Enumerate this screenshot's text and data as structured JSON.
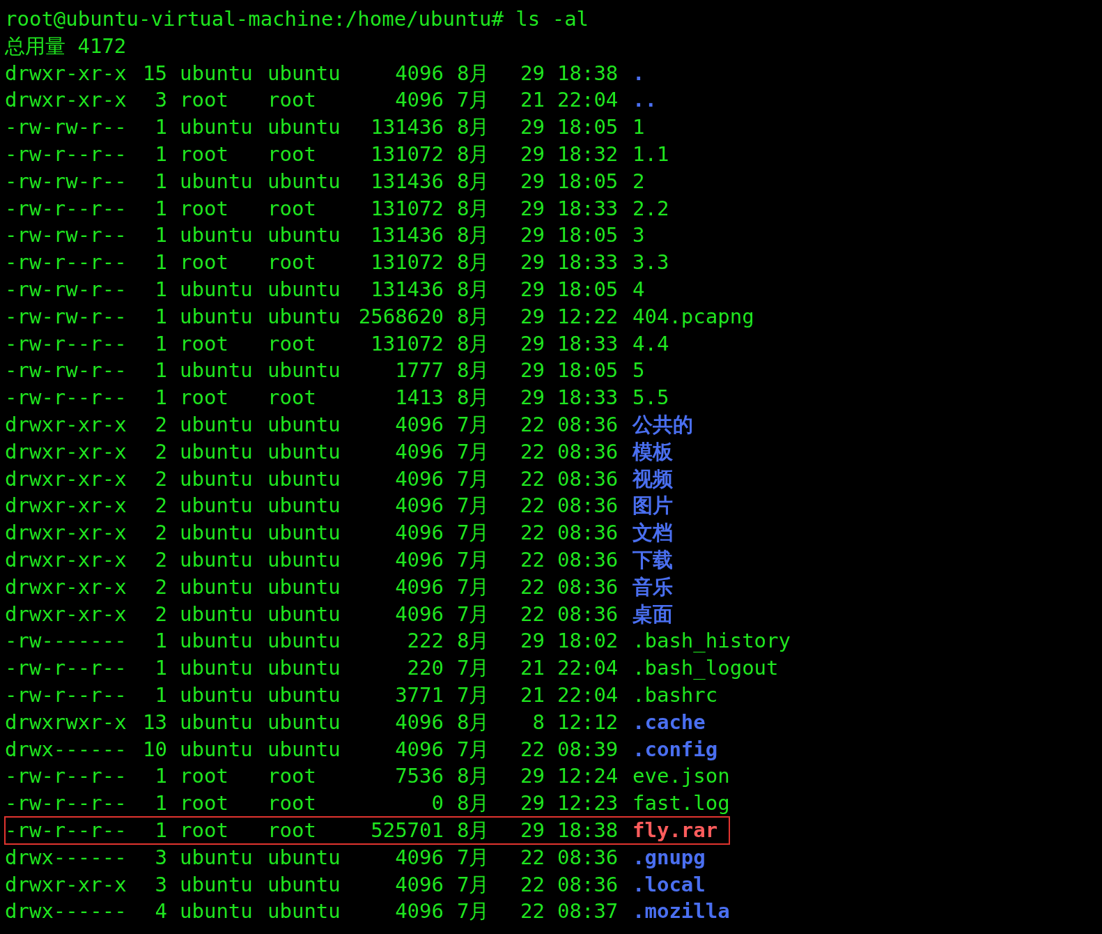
{
  "prompt": "root@ubuntu-virtual-machine:/home/ubuntu# ls -al",
  "total": "总用量 4172",
  "rows": [
    {
      "perms": "drwxr-xr-x",
      "links": "15",
      "owner": "ubuntu",
      "group": "ubuntu",
      "size": "4096",
      "month": "8月",
      "day": "29",
      "time": "18:38",
      "name": ".",
      "kind": "dir",
      "highlighted": false
    },
    {
      "perms": "drwxr-xr-x",
      "links": "3",
      "owner": "root",
      "group": "root",
      "size": "4096",
      "month": "7月",
      "day": "21",
      "time": "22:04",
      "name": "..",
      "kind": "dir",
      "highlighted": false
    },
    {
      "perms": "-rw-rw-r--",
      "links": "1",
      "owner": "ubuntu",
      "group": "ubuntu",
      "size": "131436",
      "month": "8月",
      "day": "29",
      "time": "18:05",
      "name": "1",
      "kind": "file",
      "highlighted": false
    },
    {
      "perms": "-rw-r--r--",
      "links": "1",
      "owner": "root",
      "group": "root",
      "size": "131072",
      "month": "8月",
      "day": "29",
      "time": "18:32",
      "name": "1.1",
      "kind": "file",
      "highlighted": false
    },
    {
      "perms": "-rw-rw-r--",
      "links": "1",
      "owner": "ubuntu",
      "group": "ubuntu",
      "size": "131436",
      "month": "8月",
      "day": "29",
      "time": "18:05",
      "name": "2",
      "kind": "file",
      "highlighted": false
    },
    {
      "perms": "-rw-r--r--",
      "links": "1",
      "owner": "root",
      "group": "root",
      "size": "131072",
      "month": "8月",
      "day": "29",
      "time": "18:33",
      "name": "2.2",
      "kind": "file",
      "highlighted": false
    },
    {
      "perms": "-rw-rw-r--",
      "links": "1",
      "owner": "ubuntu",
      "group": "ubuntu",
      "size": "131436",
      "month": "8月",
      "day": "29",
      "time": "18:05",
      "name": "3",
      "kind": "file",
      "highlighted": false
    },
    {
      "perms": "-rw-r--r--",
      "links": "1",
      "owner": "root",
      "group": "root",
      "size": "131072",
      "month": "8月",
      "day": "29",
      "time": "18:33",
      "name": "3.3",
      "kind": "file",
      "highlighted": false
    },
    {
      "perms": "-rw-rw-r--",
      "links": "1",
      "owner": "ubuntu",
      "group": "ubuntu",
      "size": "131436",
      "month": "8月",
      "day": "29",
      "time": "18:05",
      "name": "4",
      "kind": "file",
      "highlighted": false
    },
    {
      "perms": "-rw-rw-r--",
      "links": "1",
      "owner": "ubuntu",
      "group": "ubuntu",
      "size": "2568620",
      "month": "8月",
      "day": "29",
      "time": "12:22",
      "name": "404.pcapng",
      "kind": "file",
      "highlighted": false
    },
    {
      "perms": "-rw-r--r--",
      "links": "1",
      "owner": "root",
      "group": "root",
      "size": "131072",
      "month": "8月",
      "day": "29",
      "time": "18:33",
      "name": "4.4",
      "kind": "file",
      "highlighted": false
    },
    {
      "perms": "-rw-rw-r--",
      "links": "1",
      "owner": "ubuntu",
      "group": "ubuntu",
      "size": "1777",
      "month": "8月",
      "day": "29",
      "time": "18:05",
      "name": "5",
      "kind": "file",
      "highlighted": false
    },
    {
      "perms": "-rw-r--r--",
      "links": "1",
      "owner": "root",
      "group": "root",
      "size": "1413",
      "month": "8月",
      "day": "29",
      "time": "18:33",
      "name": "5.5",
      "kind": "file",
      "highlighted": false
    },
    {
      "perms": "drwxr-xr-x",
      "links": "2",
      "owner": "ubuntu",
      "group": "ubuntu",
      "size": "4096",
      "month": "7月",
      "day": "22",
      "time": "08:36",
      "name": "公共的",
      "kind": "dir",
      "highlighted": false
    },
    {
      "perms": "drwxr-xr-x",
      "links": "2",
      "owner": "ubuntu",
      "group": "ubuntu",
      "size": "4096",
      "month": "7月",
      "day": "22",
      "time": "08:36",
      "name": "模板",
      "kind": "dir",
      "highlighted": false
    },
    {
      "perms": "drwxr-xr-x",
      "links": "2",
      "owner": "ubuntu",
      "group": "ubuntu",
      "size": "4096",
      "month": "7月",
      "day": "22",
      "time": "08:36",
      "name": "视频",
      "kind": "dir",
      "highlighted": false
    },
    {
      "perms": "drwxr-xr-x",
      "links": "2",
      "owner": "ubuntu",
      "group": "ubuntu",
      "size": "4096",
      "month": "7月",
      "day": "22",
      "time": "08:36",
      "name": "图片",
      "kind": "dir",
      "highlighted": false
    },
    {
      "perms": "drwxr-xr-x",
      "links": "2",
      "owner": "ubuntu",
      "group": "ubuntu",
      "size": "4096",
      "month": "7月",
      "day": "22",
      "time": "08:36",
      "name": "文档",
      "kind": "dir",
      "highlighted": false
    },
    {
      "perms": "drwxr-xr-x",
      "links": "2",
      "owner": "ubuntu",
      "group": "ubuntu",
      "size": "4096",
      "month": "7月",
      "day": "22",
      "time": "08:36",
      "name": "下载",
      "kind": "dir",
      "highlighted": false
    },
    {
      "perms": "drwxr-xr-x",
      "links": "2",
      "owner": "ubuntu",
      "group": "ubuntu",
      "size": "4096",
      "month": "7月",
      "day": "22",
      "time": "08:36",
      "name": "音乐",
      "kind": "dir",
      "highlighted": false
    },
    {
      "perms": "drwxr-xr-x",
      "links": "2",
      "owner": "ubuntu",
      "group": "ubuntu",
      "size": "4096",
      "month": "7月",
      "day": "22",
      "time": "08:36",
      "name": "桌面",
      "kind": "dir",
      "highlighted": false
    },
    {
      "perms": "-rw-------",
      "links": "1",
      "owner": "ubuntu",
      "group": "ubuntu",
      "size": "222",
      "month": "8月",
      "day": "29",
      "time": "18:02",
      "name": ".bash_history",
      "kind": "file",
      "highlighted": false
    },
    {
      "perms": "-rw-r--r--",
      "links": "1",
      "owner": "ubuntu",
      "group": "ubuntu",
      "size": "220",
      "month": "7月",
      "day": "21",
      "time": "22:04",
      "name": ".bash_logout",
      "kind": "file",
      "highlighted": false
    },
    {
      "perms": "-rw-r--r--",
      "links": "1",
      "owner": "ubuntu",
      "group": "ubuntu",
      "size": "3771",
      "month": "7月",
      "day": "21",
      "time": "22:04",
      "name": ".bashrc",
      "kind": "file",
      "highlighted": false
    },
    {
      "perms": "drwxrwxr-x",
      "links": "13",
      "owner": "ubuntu",
      "group": "ubuntu",
      "size": "4096",
      "month": "8月",
      "day": "8",
      "time": "12:12",
      "name": ".cache",
      "kind": "dir",
      "highlighted": false
    },
    {
      "perms": "drwx------",
      "links": "10",
      "owner": "ubuntu",
      "group": "ubuntu",
      "size": "4096",
      "month": "7月",
      "day": "22",
      "time": "08:39",
      "name": ".config",
      "kind": "dir",
      "highlighted": false
    },
    {
      "perms": "-rw-r--r--",
      "links": "1",
      "owner": "root",
      "group": "root",
      "size": "7536",
      "month": "8月",
      "day": "29",
      "time": "12:24",
      "name": "eve.json",
      "kind": "file",
      "highlighted": false
    },
    {
      "perms": "-rw-r--r--",
      "links": "1",
      "owner": "root",
      "group": "root",
      "size": "0",
      "month": "8月",
      "day": "29",
      "time": "12:23",
      "name": "fast.log",
      "kind": "file",
      "highlighted": false
    },
    {
      "perms": "-rw-r--r--",
      "links": "1",
      "owner": "root",
      "group": "root",
      "size": "525701",
      "month": "8月",
      "day": "29",
      "time": "18:38",
      "name": "fly.rar",
      "kind": "archive",
      "highlighted": true
    },
    {
      "perms": "drwx------",
      "links": "3",
      "owner": "ubuntu",
      "group": "ubuntu",
      "size": "4096",
      "month": "7月",
      "day": "22",
      "time": "08:36",
      "name": ".gnupg",
      "kind": "dir",
      "highlighted": false
    },
    {
      "perms": "drwxr-xr-x",
      "links": "3",
      "owner": "ubuntu",
      "group": "ubuntu",
      "size": "4096",
      "month": "7月",
      "day": "22",
      "time": "08:36",
      "name": ".local",
      "kind": "dir",
      "highlighted": false
    },
    {
      "perms": "drwx------",
      "links": "4",
      "owner": "ubuntu",
      "group": "ubuntu",
      "size": "4096",
      "month": "7月",
      "day": "22",
      "time": "08:37",
      "name": ".mozilla",
      "kind": "dir",
      "highlighted": false
    }
  ]
}
